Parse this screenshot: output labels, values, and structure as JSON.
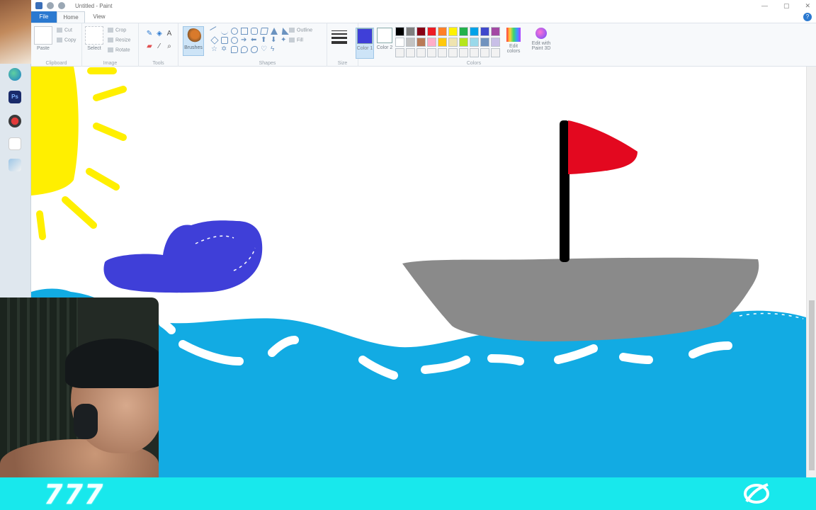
{
  "window": {
    "title": "Untitled - Paint",
    "controls": [
      "—",
      "▢",
      "✕"
    ]
  },
  "menu": {
    "file": "File",
    "tabs": [
      "Home",
      "View"
    ]
  },
  "ribbon": {
    "clipboard": {
      "paste": "Paste",
      "cut": "Cut",
      "copy": "Copy",
      "label": "Clipboard"
    },
    "image": {
      "select": "Select",
      "crop": "Crop",
      "resize": "Resize",
      "rotate": "Rotate",
      "label": "Image"
    },
    "tools": {
      "label": "Tools"
    },
    "brushes": {
      "label": "Brushes"
    },
    "shapes": {
      "outline": "Outline",
      "fill": "Fill",
      "label": "Shapes"
    },
    "size": {
      "label": "Size"
    },
    "color1": {
      "label": "Color 1",
      "value": "#3f3fd8"
    },
    "color2": {
      "label": "Color 2",
      "value": "#ffffff"
    },
    "colors": {
      "label": "Colors"
    },
    "edit_colors": "Edit colors",
    "paint3d": "Edit with Paint 3D",
    "palette": [
      "#000000",
      "#7f7f7f",
      "#880015",
      "#ed1c24",
      "#ff7f27",
      "#fff200",
      "#22b14c",
      "#00a2e8",
      "#3f48cc",
      "#a349a4",
      "#ffffff",
      "#c3c3c3",
      "#b97a57",
      "#ffaec9",
      "#ffc90e",
      "#efe4b0",
      "#b5e61d",
      "#99d9ea",
      "#7092be",
      "#c8bfe7",
      "#f2f2f2",
      "#f2f2f2",
      "#f2f2f2",
      "#f2f2f2",
      "#f2f2f2",
      "#f2f2f2",
      "#f2f2f2",
      "#f2f2f2",
      "#f2f2f2",
      "#f2f2f2"
    ]
  },
  "drawing": {
    "colors": {
      "sun": "#ffef00",
      "cloud": "#3f3fd8",
      "water": "#12abe3",
      "boat_hull": "#8a8a8a",
      "mast": "#000000",
      "flag": "#e3081f"
    }
  },
  "overlay": {
    "number": "777",
    "bar_color": "#18e8ec"
  }
}
